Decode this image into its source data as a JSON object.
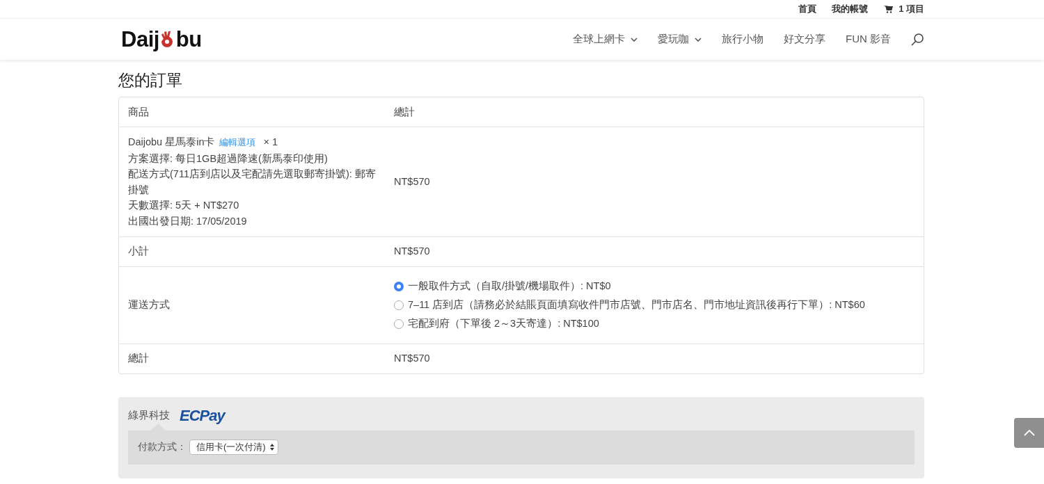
{
  "top_bar": {
    "links": [
      "首頁",
      "我的帳號"
    ],
    "cart": "1 項目"
  },
  "logo": {
    "before": "Daij",
    "after": "bu"
  },
  "nav": [
    {
      "label": "全球上網卡",
      "has_menu": true
    },
    {
      "label": "愛玩咖",
      "has_menu": true
    },
    {
      "label": "旅行小物",
      "has_menu": false
    },
    {
      "label": "好文分享",
      "has_menu": false
    },
    {
      "label": "FUN 影音",
      "has_menu": false
    }
  ],
  "title": "您的訂單",
  "order": {
    "columns": [
      "商品",
      "總計"
    ],
    "item": {
      "name": "Daijobu 星馬泰in卡",
      "edit_link": "編輯選項",
      "quantity": "× 1",
      "details": [
        "方案選擇: 每日1GB超過降速(新馬泰印使用)",
        "配送方式(711店到店以及宅配請先選取郵寄掛號): 郵寄掛號",
        "天數選擇: 5天 + NT$270",
        "出國出發日期: 17/05/2019"
      ],
      "total": "NT$570"
    },
    "subtotal": {
      "label": "小計",
      "value": "NT$570"
    },
    "shipping": {
      "label": "運送方式",
      "options": [
        {
          "label": "一般取件方式（自取/掛號/機場取件）: NT$0",
          "selected": true
        },
        {
          "label": "7–11 店到店（請務必於結賬頁面填寫收件門市店號、門市店名、門市地址資訊後再行下單）: NT$60",
          "selected": false
        },
        {
          "label": "宅配到府（下單後 2～3天寄達）: NT$100",
          "selected": false
        }
      ]
    },
    "total": {
      "label": "總計",
      "value": "NT$570"
    }
  },
  "payment": {
    "provider": "綠界科技",
    "brand": "ECPay",
    "method_label": "付款方式：",
    "method_value": "信用卡(一次付清)"
  }
}
